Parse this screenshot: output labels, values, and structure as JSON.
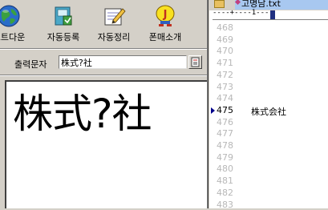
{
  "toolbar": {
    "buttons": [
      {
        "label": "트트다운",
        "icon": "globe-icon"
      },
      {
        "label": "자동등록",
        "icon": "register-icon"
      },
      {
        "label": "자동정리",
        "icon": "notepad-pencil-icon"
      },
      {
        "label": "폰매소개",
        "icon": "mascot-j-icon"
      }
    ]
  },
  "output": {
    "label": "출력문자",
    "value": "株式?社"
  },
  "preview": {
    "text": "株式?社"
  },
  "editor": {
    "tab_filename": "고명남.txt",
    "ruler": "----+----1----",
    "lines": [
      {
        "num": "468",
        "text": ""
      },
      {
        "num": "469",
        "text": ""
      },
      {
        "num": "470",
        "text": ""
      },
      {
        "num": "471",
        "text": ""
      },
      {
        "num": "472",
        "text": ""
      },
      {
        "num": "473",
        "text": ""
      },
      {
        "num": "474",
        "text": ""
      },
      {
        "num": "475",
        "text": "株式会社",
        "current": true
      },
      {
        "num": "476",
        "text": ""
      },
      {
        "num": "477",
        "text": ""
      },
      {
        "num": "478",
        "text": ""
      },
      {
        "num": "479",
        "text": ""
      },
      {
        "num": "480",
        "text": ""
      },
      {
        "num": "481",
        "text": ""
      },
      {
        "num": "482",
        "text": ""
      },
      {
        "num": "483",
        "text": ""
      }
    ]
  }
}
